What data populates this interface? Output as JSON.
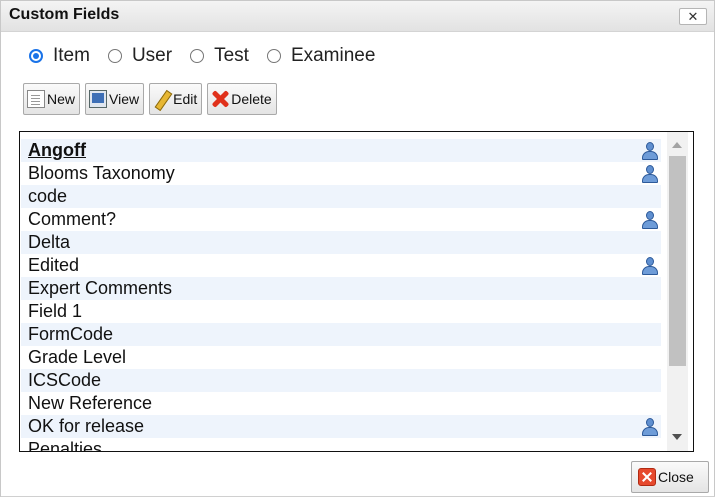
{
  "window": {
    "title": "Custom Fields",
    "close_glyph": "✕"
  },
  "radios": [
    {
      "label": "Item",
      "checked": true
    },
    {
      "label": "User",
      "checked": false
    },
    {
      "label": "Test",
      "checked": false
    },
    {
      "label": "Examinee",
      "checked": false
    }
  ],
  "toolbar": {
    "new_label": "New",
    "view_label": "View",
    "edit_label": "Edit",
    "delete_label": "Delete"
  },
  "fields": [
    {
      "label": "Angoff",
      "selected": true,
      "user_icon": true
    },
    {
      "label": "Blooms Taxonomy",
      "user_icon": true
    },
    {
      "label": "code",
      "user_icon": false
    },
    {
      "label": "Comment?",
      "user_icon": true
    },
    {
      "label": "Delta",
      "user_icon": false
    },
    {
      "label": "Edited",
      "user_icon": true
    },
    {
      "label": "Expert Comments",
      "user_icon": false
    },
    {
      "label": "Field 1",
      "user_icon": false
    },
    {
      "label": "FormCode",
      "user_icon": false
    },
    {
      "label": "Grade Level",
      "user_icon": false
    },
    {
      "label": "ICSCode",
      "user_icon": false
    },
    {
      "label": "New Reference",
      "user_icon": false
    },
    {
      "label": "OK for release",
      "user_icon": true
    },
    {
      "label": "Penalties",
      "user_icon": false
    }
  ],
  "footer": {
    "close_label": "Close"
  },
  "colors": {
    "accent": "#1a73e8",
    "row_alt": "#eef4fc",
    "user_icon": "#5f8fd0"
  }
}
